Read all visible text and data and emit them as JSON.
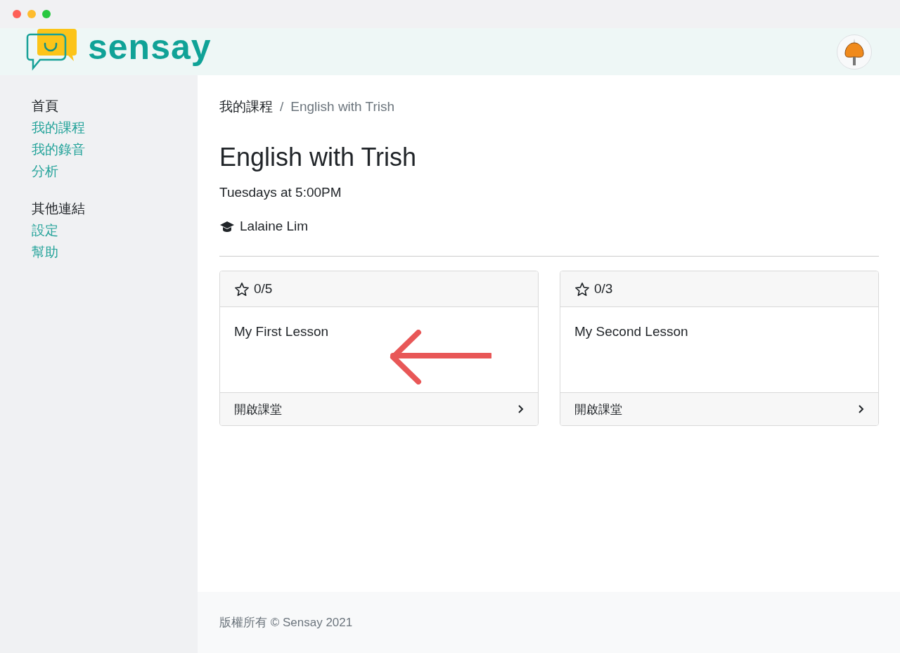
{
  "brand": {
    "name": "sensay"
  },
  "sidebar": {
    "groups": [
      {
        "heading": "首頁",
        "items": [
          {
            "label": "我的課程"
          },
          {
            "label": "我的錄音"
          },
          {
            "label": "分析"
          }
        ]
      },
      {
        "heading": "其他連結",
        "items": [
          {
            "label": "設定"
          },
          {
            "label": "幫助"
          }
        ]
      }
    ]
  },
  "breadcrumb_separator": "/",
  "breadcrumb": [
    {
      "label": "我的課程"
    },
    {
      "label": "English with Trish"
    }
  ],
  "course": {
    "title": "English with Trish",
    "schedule": "Tuesdays at 5:00PM",
    "teacher": "Lalaine Lim"
  },
  "lessons": [
    {
      "stars": "0/5",
      "title": "My First Lesson",
      "action": "開啟課堂",
      "annotated": true
    },
    {
      "stars": "0/3",
      "title": "My Second Lesson",
      "action": "開啟課堂",
      "annotated": false
    }
  ],
  "footer": {
    "text": "版權所有 © Sensay 2021"
  }
}
